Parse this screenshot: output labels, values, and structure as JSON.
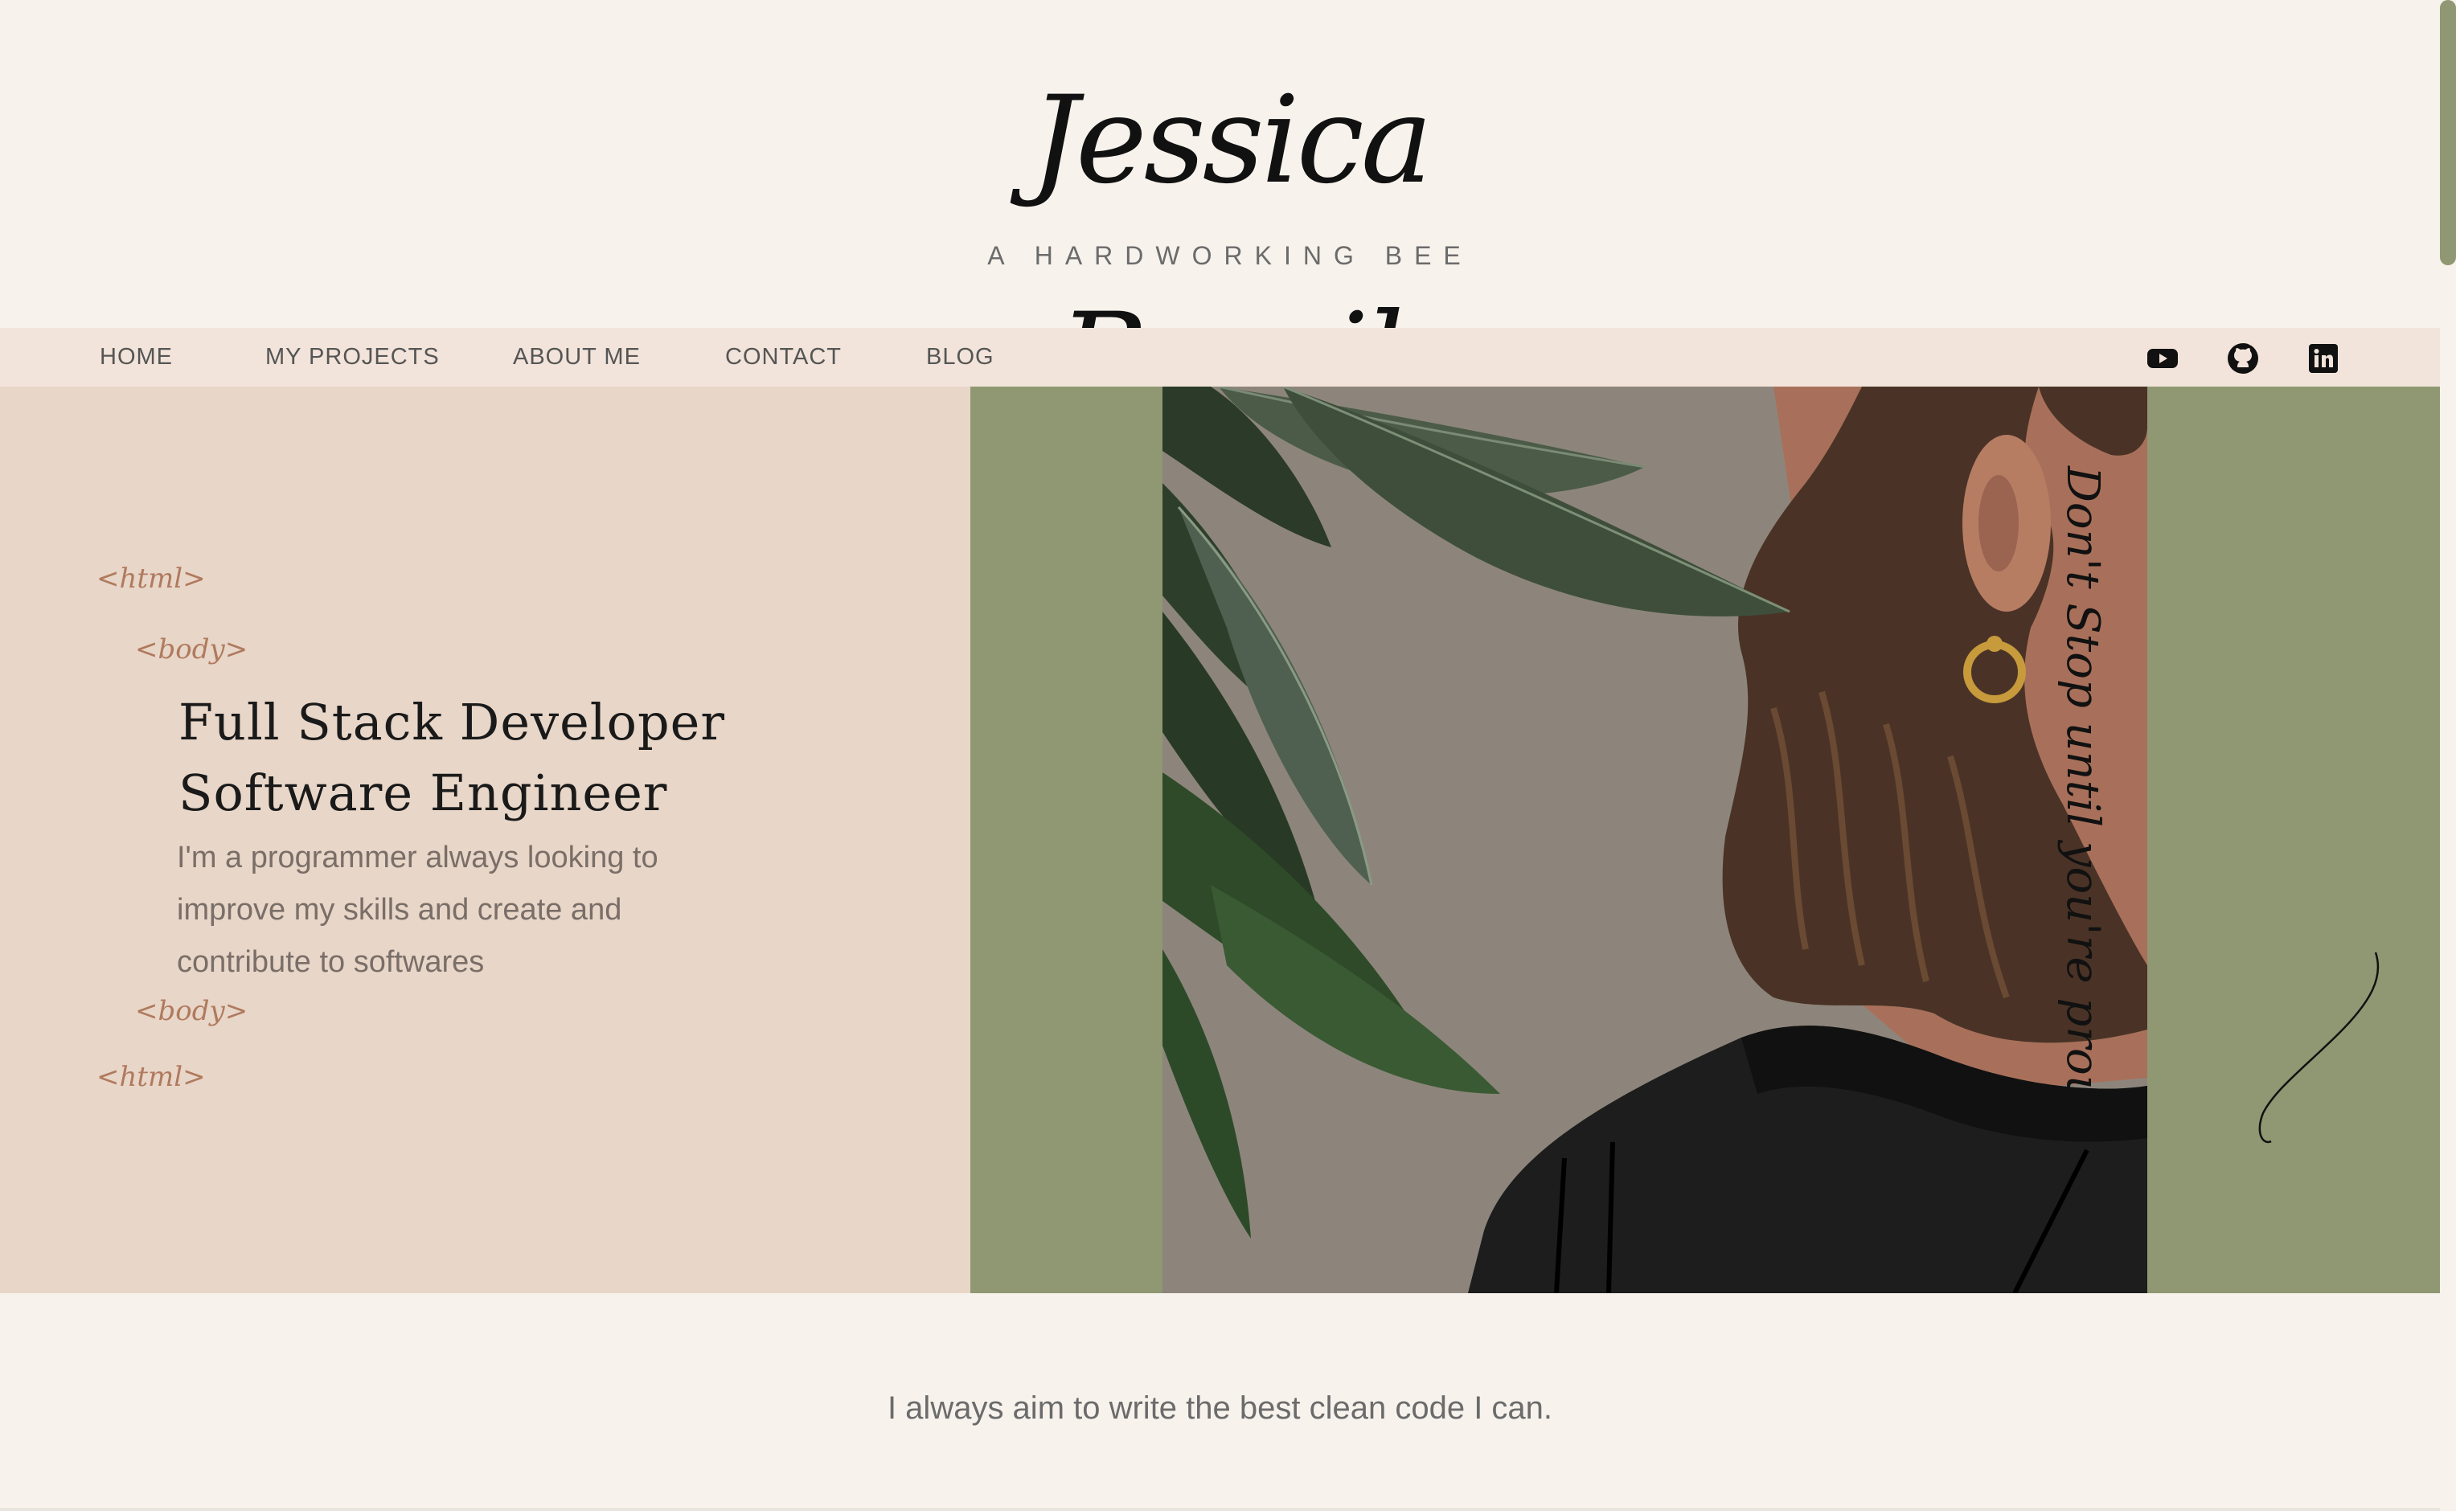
{
  "header": {
    "title": "Jessica Bassil",
    "tagline": "A HARDWORKING BEE"
  },
  "nav": {
    "items": [
      "HOME",
      "MY PROJECTS",
      "ABOUT ME",
      "CONTACT",
      "BLOG"
    ]
  },
  "social": {
    "icons": [
      "youtube-icon",
      "github-icon",
      "linkedin-icon"
    ]
  },
  "hero": {
    "tags": {
      "html_open": "<html>",
      "body_open": "<body>",
      "body_close": "<body>",
      "html_close": "<html>"
    },
    "heading_line1": "Full Stack Developer",
    "heading_line2": "Software Engineer",
    "description": "I'm a programmer always looking to improve my skills and create and contribute to softwares",
    "quote": "Don't Stop until you're proud"
  },
  "bottom": {
    "text": "I always aim to write the best clean code I can."
  },
  "colors": {
    "background": "#f7f2ec",
    "nav_background": "#f2e4da",
    "hero_left": "#e8d6c8",
    "hero_right": "#8f9872",
    "accent_tag": "#b07a5e"
  }
}
